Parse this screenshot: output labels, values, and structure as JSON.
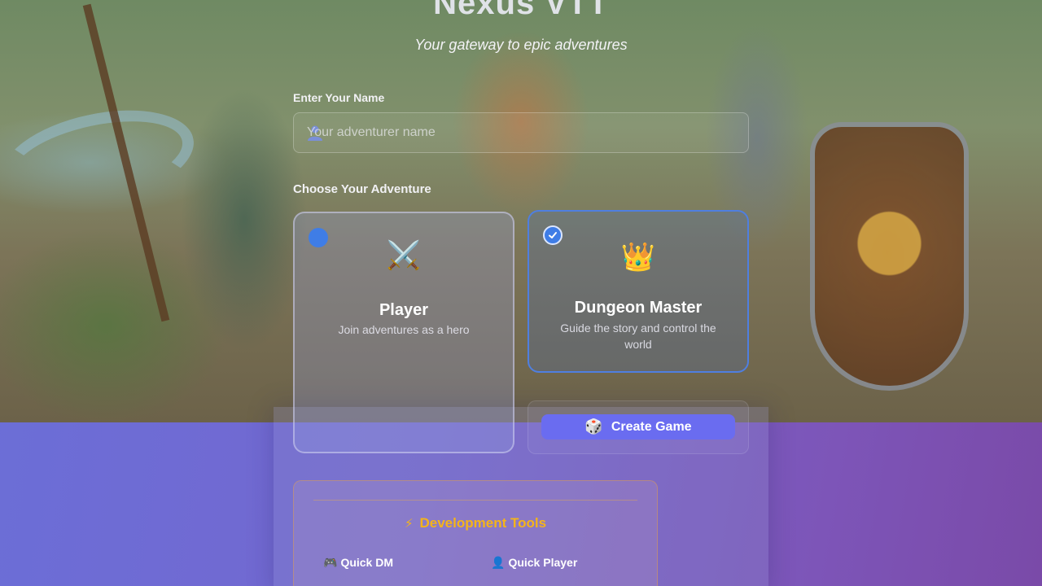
{
  "header": {
    "title": "Nexus VTT",
    "subtitle": "Your gateway to epic adventures"
  },
  "name_section": {
    "label": "Enter Your Name",
    "placeholder": "Your adventurer name",
    "value": "",
    "icon": "user-icon"
  },
  "adventure": {
    "label": "Choose Your Adventure",
    "selected": "dungeon-master",
    "options": [
      {
        "id": "player",
        "icon": "crossed-swords-icon",
        "glyph": "⚔️",
        "title": "Player",
        "description": "Join adventures as a hero"
      },
      {
        "id": "dungeon-master",
        "icon": "crown-icon",
        "glyph": "👑",
        "title": "Dungeon Master",
        "description": "Guide the story and control the world"
      }
    ]
  },
  "create_game": {
    "icon": "dice-icon",
    "glyph": "🎲",
    "label": "Create Game"
  },
  "dev_tools": {
    "icon": "lightning-icon",
    "glyph": "⚡",
    "title": "Development Tools",
    "buttons": [
      {
        "icon": "gamepad-icon",
        "glyph": "🎮",
        "label": "Quick DM"
      },
      {
        "icon": "user-icon",
        "glyph": "👤",
        "label": "Quick Player"
      }
    ]
  },
  "colors": {
    "accent_blue": "#3f7de6",
    "button_indigo": "#6a6cf0",
    "dev_gold": "#f4b41a"
  }
}
